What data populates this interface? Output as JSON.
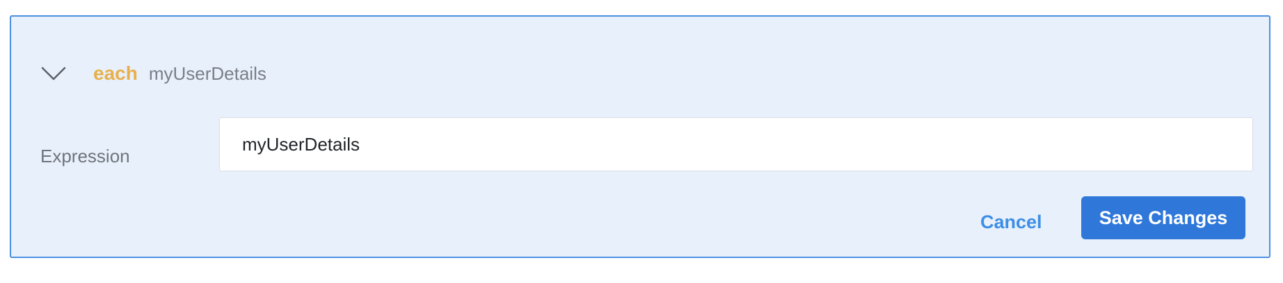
{
  "block": {
    "keyword": "each",
    "expression_name": "myUserDetails",
    "collapse_icon": "chevron-down-icon"
  },
  "form": {
    "expression_label": "Expression",
    "expression_value": "myUserDetails"
  },
  "actions": {
    "cancel_label": "Cancel",
    "save_label": "Save Changes"
  },
  "colors": {
    "panel_background": "#e8f0fb",
    "panel_border": "#4a90e2",
    "keyword": "#e8b04b",
    "primary_button": "#2f78d9",
    "link": "#3d8ee6"
  }
}
